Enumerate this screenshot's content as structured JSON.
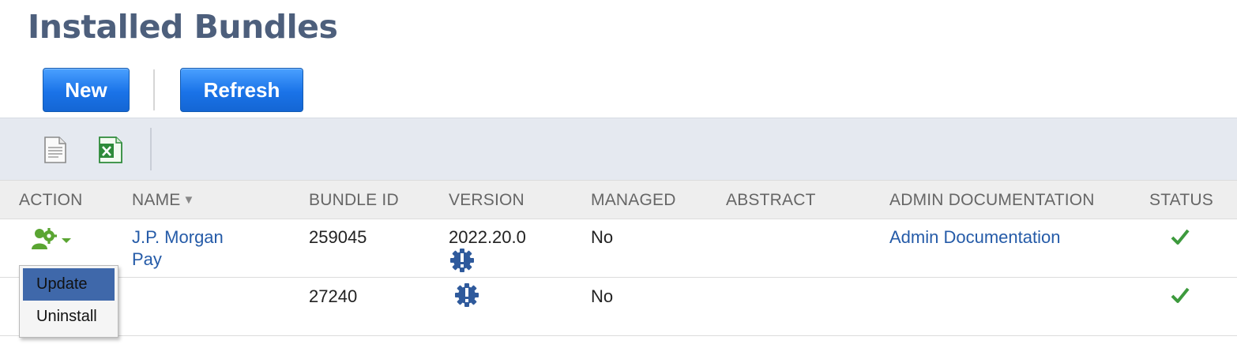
{
  "page": {
    "title": "Installed Bundles"
  },
  "buttons": {
    "new": "New",
    "refresh": "Refresh"
  },
  "toolbar": {
    "icons": [
      "print-icon",
      "export-excel-icon"
    ]
  },
  "table": {
    "columns": [
      "ACTION",
      "NAME",
      "BUNDLE ID",
      "VERSION",
      "MANAGED",
      "ABSTRACT",
      "ADMIN DOCUMENTATION",
      "STATUS"
    ],
    "sort_indicator": "▼",
    "rows": [
      {
        "name_line1": "J.P. Morgan",
        "name_line2": "Pay",
        "bundle_id": "259045",
        "version": "2022.20.0",
        "version_icon": "update-available-icon",
        "managed": "No",
        "abstract": "",
        "admin_documentation": "Admin Documentation",
        "status_icon": "check-icon"
      },
      {
        "name_line1": "",
        "name_line2": "",
        "bundle_id": "27240",
        "version": "",
        "version_icon": "update-available-icon",
        "managed": "No",
        "abstract": "",
        "admin_documentation": "",
        "status_icon": "check-icon"
      }
    ]
  },
  "action_menu": {
    "items": [
      "Update",
      "Uninstall"
    ],
    "selected": "Update"
  },
  "colors": {
    "title": "#4d5f7c",
    "button": "#1a73e8",
    "link": "#255ba8",
    "toolbar_bg": "#e5e9f0",
    "menu_highlight": "#3f68aa",
    "check": "#3d9a3d",
    "action_icon": "#5aa532"
  }
}
